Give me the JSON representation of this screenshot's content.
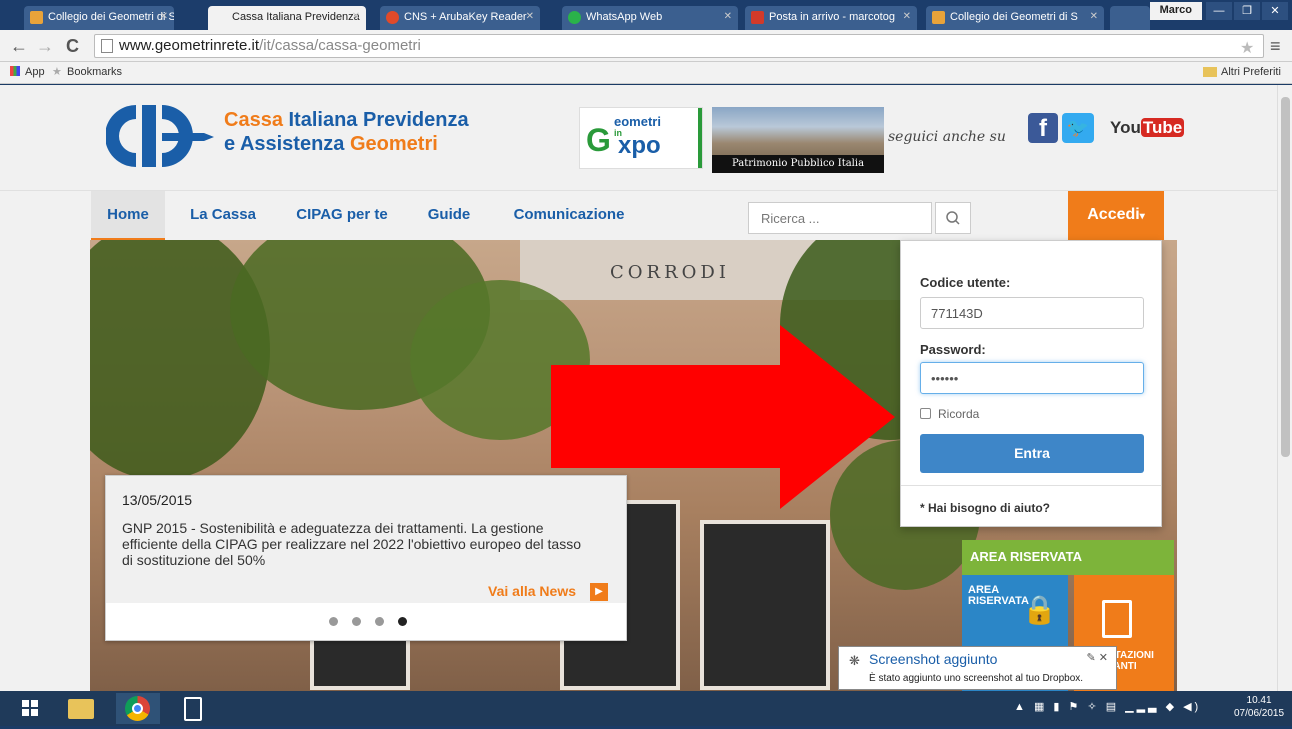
{
  "browser": {
    "tabs": [
      {
        "label": "Collegio dei Geometri di S",
        "icon_color": "#e8a33a",
        "active": false
      },
      {
        "label": "Cassa Italiana Previdenza",
        "icon_color": "#3a78c7",
        "active": true
      },
      {
        "label": "CNS + ArubaKey Reader",
        "icon_color": "#e04a2a",
        "active": false
      },
      {
        "label": "WhatsApp Web",
        "icon_color": "#2ab34a",
        "active": false
      },
      {
        "label": "Posta in arrivo - marcotog",
        "icon_color": "#d23a2a",
        "active": false
      },
      {
        "label": "Collegio dei Geometri di S",
        "icon_color": "#e8a33a",
        "active": false
      }
    ],
    "user": "Marco",
    "url_host": "www.geometrinrete.it",
    "url_path": "/it/cassa/cassa-geometri",
    "bookmarks": {
      "apps": "App",
      "bookmarks": "Bookmarks",
      "other": "Altri Preferiti"
    }
  },
  "header": {
    "brand_line1_a": "Cassa",
    "brand_line1_b": "Italiana Previdenza",
    "brand_line2_a": "e Assistenza",
    "brand_line2_b": "Geometri",
    "expo_top": "eometri",
    "expo_in": "in",
    "expo_bottom": "xpo",
    "patrimonio": "Patrimonio Pubblico Italia",
    "seguici": "seguici anche su",
    "youtube_a": "You",
    "youtube_b": "Tube"
  },
  "nav": {
    "items": [
      "Home",
      "La Cassa",
      "CIPAG per te",
      "Guide",
      "Comunicazione"
    ],
    "search_placeholder": "Ricerca ...",
    "accedi": "Accedi"
  },
  "hero": {
    "inscription": "CORRODI"
  },
  "news": {
    "date": "13/05/2015",
    "text": "GNP 2015 - Sostenibilità e adeguatezza dei trattamenti. La gestione efficiente della CIPAG per realizzare nel 2022 l'obiettivo europeo del tasso di sostituzione del 50%",
    "link": "Vai alla News"
  },
  "tiles": {
    "area_riservata_wide": "AREA RISERVATA",
    "area_riservata": "AREA\nRISERVATA",
    "prestazioni": "STAZIONI\nTANTI"
  },
  "login": {
    "user_label": "Codice utente:",
    "user_value": "771143D",
    "password_label": "Password:",
    "password_value": "••••••",
    "remember": "Ricorda",
    "submit": "Entra",
    "help": "* Hai bisogno di aiuto?"
  },
  "notification": {
    "title": "Screenshot aggiunto",
    "text": "È stato aggiunto uno screenshot al tuo Dropbox."
  },
  "taskbar": {
    "time": "10.41",
    "date": "07/06/2015"
  }
}
